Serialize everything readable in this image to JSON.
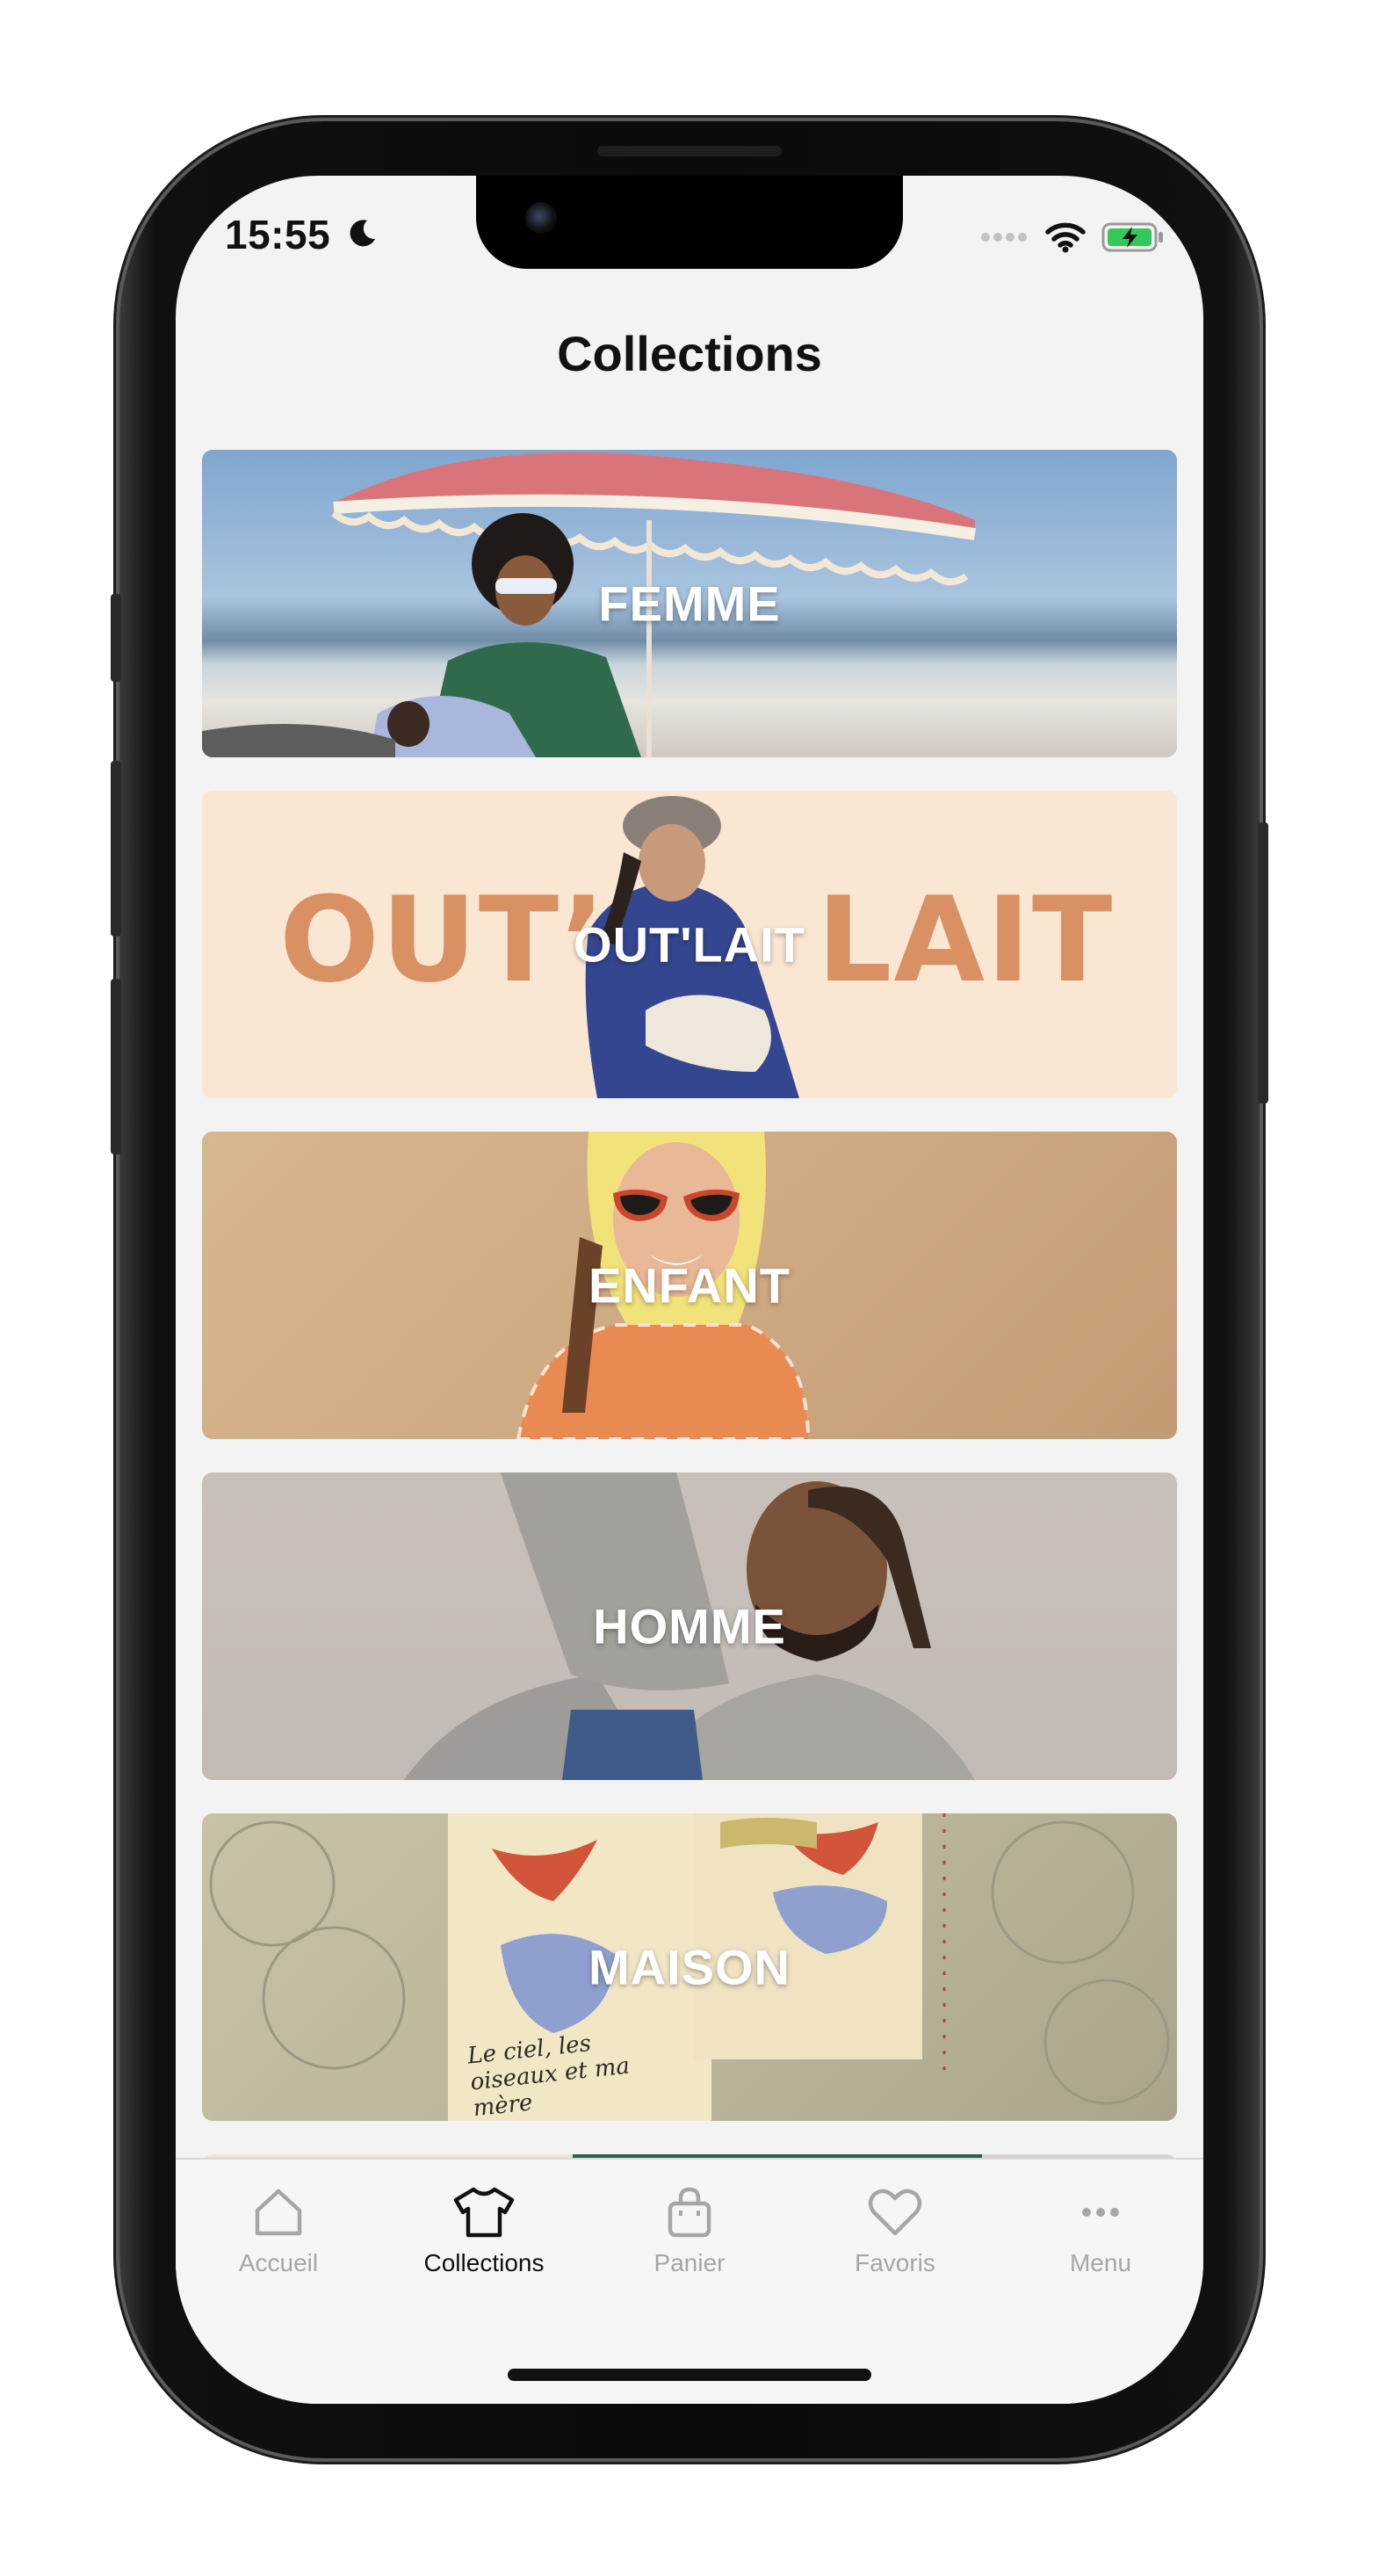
{
  "status_bar": {
    "time": "15:55",
    "moon_icon": "moon-icon",
    "signal_icon": "signal-icon",
    "wifi_icon": "wifi-icon",
    "battery_icon": "battery-charging-icon"
  },
  "header": {
    "title": "Collections"
  },
  "collections": [
    {
      "label": "FEMME",
      "theme": "beach"
    },
    {
      "label": "OUT'LAIT",
      "theme": "outlait",
      "banner_text_left": "OUT’",
      "banner_text_right": "LAIT"
    },
    {
      "label": "ENFANT",
      "theme": "enfant"
    },
    {
      "label": "HOMME",
      "theme": "homme"
    },
    {
      "label": "MAISON",
      "theme": "maison",
      "print_text": "Le ciel, les oiseaux et ma mère"
    }
  ],
  "tabbar": {
    "items": [
      {
        "label": "Accueil",
        "icon": "home-icon",
        "active": false
      },
      {
        "label": "Collections",
        "icon": "tshirt-icon",
        "active": true
      },
      {
        "label": "Panier",
        "icon": "bag-icon",
        "active": false
      },
      {
        "label": "Favoris",
        "icon": "heart-icon",
        "active": false
      },
      {
        "label": "Menu",
        "icon": "more-icon",
        "active": false
      }
    ]
  },
  "colors": {
    "background": "#f3f3f3",
    "tab_active": "#111111",
    "tab_inactive": "#a6a6a6",
    "outlait_orange": "#d99063",
    "outlait_bg": "#f9e7d3"
  }
}
